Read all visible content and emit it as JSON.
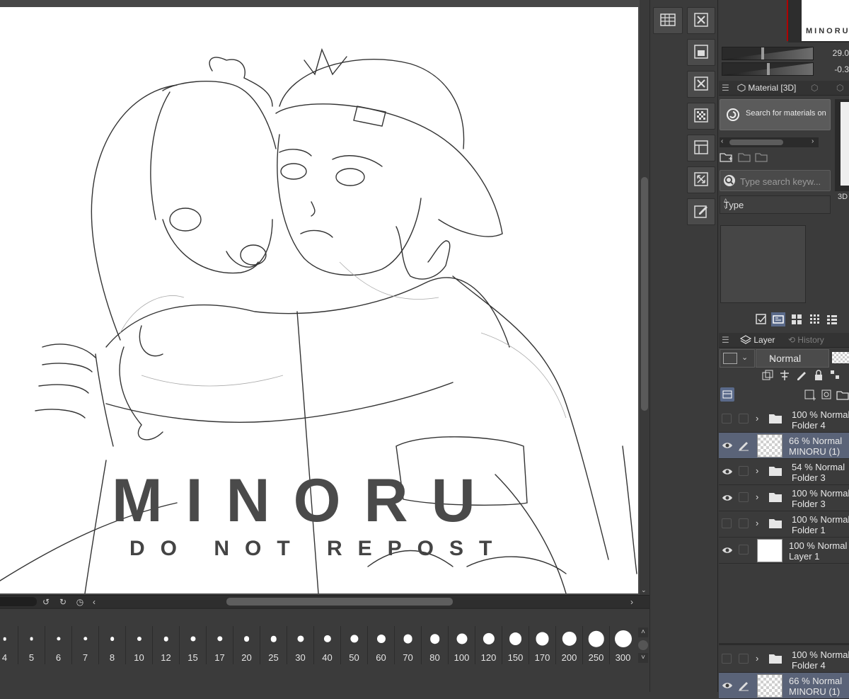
{
  "canvas": {
    "watermark_title": "MINORU",
    "watermark_subtitle": "DO NOT REPOST"
  },
  "brush_sizes": [
    "4",
    "5",
    "6",
    "7",
    "8",
    "10",
    "12",
    "15",
    "17",
    "20",
    "25",
    "30",
    "40",
    "50",
    "60",
    "70",
    "80",
    "100",
    "120",
    "150",
    "170",
    "200",
    "250",
    "300"
  ],
  "navigator": {
    "thumb_text": "MINORU",
    "slider_values": [
      "29.0",
      "-0.3"
    ]
  },
  "material_panel": {
    "tab_label": "Material [3D]",
    "search_materials_button": "Search for materials on AS",
    "search_placeholder": "Type search keyw...",
    "type_label": "Type",
    "side_label": "3D"
  },
  "layer_panel": {
    "tab_layer": "Layer",
    "tab_history": "History",
    "blend_mode": "Normal",
    "layers": [
      {
        "line1": "100 % Normal",
        "line2": "Folder 4",
        "kind": "folder",
        "visible": false,
        "selected": false
      },
      {
        "line1": "66 % Normal",
        "line2": "MINORU (1)",
        "kind": "raster",
        "visible": true,
        "selected": true
      },
      {
        "line1": "54 % Normal",
        "line2": "Folder 3",
        "kind": "folder",
        "visible": true,
        "selected": false
      },
      {
        "line1": "100 % Normal",
        "line2": "Folder 3",
        "kind": "folder",
        "visible": true,
        "selected": false
      },
      {
        "line1": "100 % Normal",
        "line2": "Folder 1",
        "kind": "folder",
        "visible": false,
        "selected": false
      },
      {
        "line1": "100 % Normal",
        "line2": "Layer 1",
        "kind": "paper",
        "visible": true,
        "selected": false
      }
    ],
    "bottom_layers": [
      {
        "line1": "100 % Normal",
        "line2": "Folder 4"
      },
      {
        "line1": "66 % Normal",
        "line2": "MINORU (1)"
      }
    ]
  },
  "colors": {
    "background": "#3b3b3b",
    "selected_row": "#5a6378",
    "canvas": "#ffffff"
  }
}
